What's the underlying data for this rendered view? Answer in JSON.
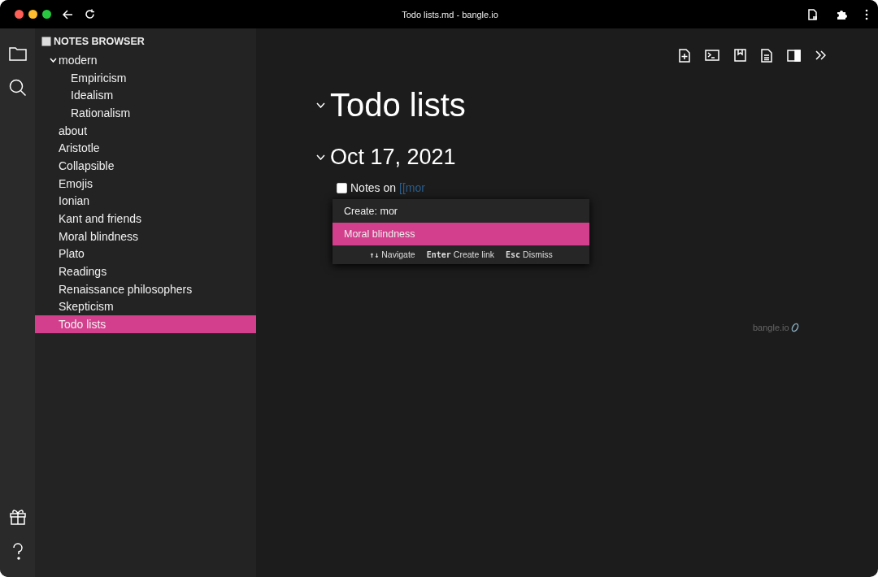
{
  "window": {
    "title": "Todo lists.md - bangle.io"
  },
  "sidebar": {
    "title": "NOTES BROWSER",
    "tree": [
      {
        "label": "modern",
        "expanded": true,
        "selected": false,
        "children": [
          {
            "label": "Empiricism",
            "selected": false
          },
          {
            "label": "Idealism",
            "selected": false
          },
          {
            "label": "Rationalism",
            "selected": false
          }
        ]
      },
      {
        "label": "about",
        "selected": false
      },
      {
        "label": "Aristotle",
        "selected": false
      },
      {
        "label": "Collapsible",
        "selected": false
      },
      {
        "label": "Emojis",
        "selected": false
      },
      {
        "label": "Ionian",
        "selected": false
      },
      {
        "label": "Kant and friends",
        "selected": false
      },
      {
        "label": "Moral blindness",
        "selected": false
      },
      {
        "label": "Plato",
        "selected": false
      },
      {
        "label": "Readings",
        "selected": false
      },
      {
        "label": "Renaissance philosophers",
        "selected": false
      },
      {
        "label": "Skepticism",
        "selected": false
      },
      {
        "label": "Todo lists",
        "selected": true
      }
    ]
  },
  "editor": {
    "heading": "Todo lists",
    "subheading": "Oct 17, 2021",
    "task": {
      "checked": false,
      "text": "Notes on",
      "link": "[[mor"
    },
    "suggestions": [
      {
        "label": "Create: mor",
        "selected": false
      },
      {
        "label": "Moral blindness",
        "selected": true
      }
    ],
    "hints": [
      {
        "key": "↑↓",
        "label": "Navigate"
      },
      {
        "key": "Enter",
        "label": "Create link"
      },
      {
        "key": "Esc",
        "label": "Dismiss"
      }
    ],
    "brand": "bangle.io"
  }
}
